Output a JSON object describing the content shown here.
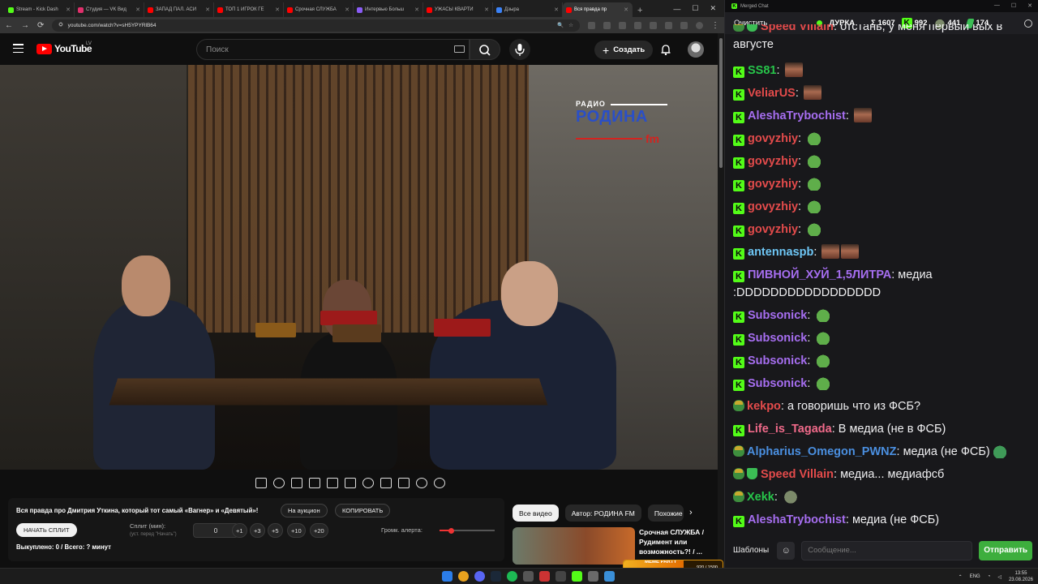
{
  "browser": {
    "tabs": [
      {
        "label": "Stream - Kick Dash",
        "color": "#53fc18",
        "active": false
      },
      {
        "label": "Студия — VK Вид",
        "color": "#e1306c",
        "active": false
      },
      {
        "label": "ЗАПАД ПАЛ. АСИ",
        "color": "#ff0000",
        "active": false
      },
      {
        "label": "ТОП 1 ИГРОК ГЕ",
        "color": "#ff0000",
        "active": false
      },
      {
        "label": "Срочная СЛУЖБА",
        "color": "#ff0000",
        "active": false
      },
      {
        "label": "Интервью Больш",
        "color": "#8a5cf6",
        "active": false
      },
      {
        "label": "УЖАСЫ КВАРТИ",
        "color": "#ff0000",
        "active": false
      },
      {
        "label": "Дзыра",
        "color": "#3b82f6",
        "active": false
      },
      {
        "label": "Вся правда пр",
        "color": "#ff0000",
        "active": true
      }
    ],
    "new_tab": "+",
    "url": "youtube.com/watch?v=sH5YPYRlB64"
  },
  "youtube": {
    "logo_text": "YouTube",
    "country": "LV",
    "search_placeholder": "Поиск",
    "create_label": "Создать"
  },
  "video": {
    "logo_radio": "РАДИО",
    "logo_main": "РОДИНА",
    "logo_fm": "fm"
  },
  "extension": {
    "title": "Вся правда про Дмитрия Уткина, который тот самый «Вагнер» и «Девятый»!",
    "auction_button": "На аукцион",
    "copy_button": "КОПИРОВАТЬ",
    "split_button": "НАЧАТЬ СПЛИТ",
    "split_label": "Сплит (мин):",
    "split_sub": "(уст. перед \"Начать\")",
    "split_value": "0",
    "increments": [
      "+1",
      "+3",
      "+5",
      "+10",
      "+20"
    ],
    "volume_label": "Громк. алерта:",
    "volume_level": 0.2,
    "bought": "Выкуплено: 0 / Всего: ? минут"
  },
  "sidebar": {
    "chips": [
      "Все видео",
      "Автор: РОДИНА FM",
      "Похожие"
    ],
    "rec_title": "Срочная СЛУЖБА / Рудимент или возможность?! / ..."
  },
  "chat": {
    "window_title": "Merged Chat",
    "clear_label": "Очистить",
    "channel": "ДУРКА",
    "sum": "Σ 1607",
    "kick_count": "992",
    "bat_count": "441",
    "other_count": "174",
    "messages": [
      {
        "badges": [
          "pepe",
          "shield"
        ],
        "user": "Speed Villain",
        "color": "#e34b4b",
        "text": "отстань, у меня первый вых в августе",
        "emotes": []
      },
      {
        "badges": [
          "kick"
        ],
        "user": "SS81",
        "color": "#27c54a",
        "text": "",
        "emotes": [
          "face"
        ]
      },
      {
        "badges": [
          "kick"
        ],
        "user": "VeliarUS",
        "color": "#e34b4b",
        "text": "",
        "emotes": [
          "face"
        ]
      },
      {
        "badges": [
          "kick"
        ],
        "user": "AleshaTrybochist",
        "color": "#a66ef0",
        "text": "",
        "emotes": [
          "face"
        ]
      },
      {
        "badges": [
          "kick"
        ],
        "user": "govyzhiy",
        "color": "#e34b4b",
        "text": "",
        "emotes": [
          "frog"
        ]
      },
      {
        "badges": [
          "kick"
        ],
        "user": "govyzhiy",
        "color": "#e34b4b",
        "text": "",
        "emotes": [
          "frog"
        ]
      },
      {
        "badges": [
          "kick"
        ],
        "user": "govyzhiy",
        "color": "#e34b4b",
        "text": "",
        "emotes": [
          "frog"
        ]
      },
      {
        "badges": [
          "kick"
        ],
        "user": "govyzhiy",
        "color": "#e34b4b",
        "text": "",
        "emotes": [
          "frog"
        ]
      },
      {
        "badges": [
          "kick"
        ],
        "user": "govyzhiy",
        "color": "#e34b4b",
        "text": "",
        "emotes": [
          "frog"
        ]
      },
      {
        "badges": [
          "kick"
        ],
        "user": "antennaspb",
        "color": "#6ec6f5",
        "text": "",
        "emotes": [
          "face",
          "face"
        ]
      },
      {
        "badges": [
          "kick"
        ],
        "user": "ПИВНОЙ_ХУЙ_1,5ЛИТРА",
        "color": "#a66ef0",
        "text": "медиа :DDDDDDDDDDDDDDDDD",
        "emotes": []
      },
      {
        "badges": [
          "kick"
        ],
        "user": "Subsonick",
        "color": "#a66ef0",
        "text": "",
        "emotes": [
          "frog"
        ]
      },
      {
        "badges": [
          "kick"
        ],
        "user": "Subsonick",
        "color": "#a66ef0",
        "text": "",
        "emotes": [
          "frog"
        ]
      },
      {
        "badges": [
          "kick"
        ],
        "user": "Subsonick",
        "color": "#a66ef0",
        "text": "",
        "emotes": [
          "frog"
        ]
      },
      {
        "badges": [
          "kick"
        ],
        "user": "Subsonick",
        "color": "#a66ef0",
        "text": "",
        "emotes": [
          "frog"
        ]
      },
      {
        "badges": [
          "pepe"
        ],
        "user": "kekpo",
        "color": "#e34b4b",
        "text": "а говоришь что из ФСБ?",
        "emotes": []
      },
      {
        "badges": [
          "kick"
        ],
        "user": "Life_is_Tagada",
        "color": "#f06a8a",
        "text": "В медиа (не в ФСБ)",
        "emotes": []
      },
      {
        "badges": [
          "pepe"
        ],
        "user": "Alpharius_Omegon_PWNZ",
        "color": "#4a8fe0",
        "text": "медиа (не ФСБ)",
        "emotes": [
          "frog2"
        ]
      },
      {
        "badges": [
          "pepe",
          "shield"
        ],
        "user": "Speed Villain",
        "color": "#e34b4b",
        "text": "медиа... медиафсб",
        "emotes": []
      },
      {
        "badges": [
          "pepe"
        ],
        "user": "Xekk",
        "color": "#27c54a",
        "text": "",
        "emotes": [
          "bat"
        ]
      },
      {
        "badges": [
          "kick"
        ],
        "user": "AleshaTrybochist",
        "color": "#a66ef0",
        "text": "медиа (не ФСБ)",
        "emotes": []
      }
    ],
    "templates_label": "Шаблоны",
    "input_placeholder": "Сообщение...",
    "send_label": "Отправить"
  },
  "taskbar": {
    "meme_label": "MEME PARTY",
    "meme_count": "920 / 1500",
    "meme_progress": 0.61,
    "lang": "ENG",
    "time": "13:55",
    "date": "23.08.2026"
  }
}
